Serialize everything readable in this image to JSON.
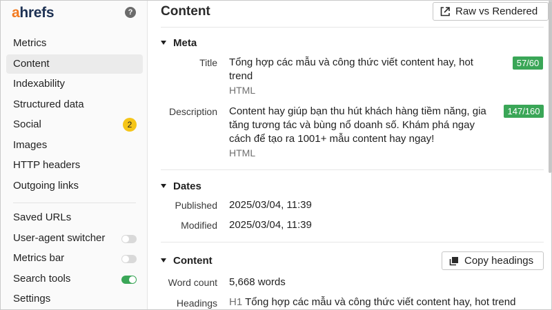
{
  "app": {
    "logo_first": "a",
    "logo_rest": "hrefs",
    "help_icon": "question-circle-icon"
  },
  "sidebar": {
    "items": [
      {
        "label": "Metrics"
      },
      {
        "label": "Content",
        "active": true
      },
      {
        "label": "Indexability"
      },
      {
        "label": "Structured data"
      },
      {
        "label": "Social",
        "badge": "2"
      },
      {
        "label": "Images"
      },
      {
        "label": "HTTP headers"
      },
      {
        "label": "Outgoing links"
      }
    ],
    "tools": [
      {
        "label": "Saved URLs"
      },
      {
        "label": "User-agent switcher",
        "toggle": false
      },
      {
        "label": "Metrics bar",
        "toggle": false
      },
      {
        "label": "Search tools",
        "toggle": true
      },
      {
        "label": "Settings"
      }
    ]
  },
  "main": {
    "title": "Content",
    "raw_button": "Raw vs Rendered",
    "meta": {
      "heading": "Meta",
      "title_label": "Title",
      "title_value": "Tổng hợp các mẫu và công thức viết content hay, hot trend",
      "title_source": "HTML",
      "title_count": "57/60",
      "desc_label": "Description",
      "desc_value": "Content hay giúp bạn thu hút khách hàng tiềm năng, gia tăng tương tác và bùng nổ doanh số. Khám phá ngay cách để tạo ra 1001+ mẫu content hay ngay!",
      "desc_source": "HTML",
      "desc_count": "147/160"
    },
    "dates": {
      "heading": "Dates",
      "published_label": "Published",
      "published_value": "2025/03/04, 11:39",
      "modified_label": "Modified",
      "modified_value": "2025/03/04, 11:39"
    },
    "content": {
      "heading": "Content",
      "copy_button": "Copy headings",
      "word_count_label": "Word count",
      "word_count_value": "5,668 words",
      "headings_label": "Headings",
      "h1_tag": "H1",
      "h1_value": "Tổng hợp các mẫu và công thức viết content hay, hot trend"
    }
  },
  "colors": {
    "accent_green": "#3aa657",
    "badge_yellow": "#f5c518",
    "logo_orange": "#f37a1f",
    "logo_navy": "#1d3153"
  }
}
